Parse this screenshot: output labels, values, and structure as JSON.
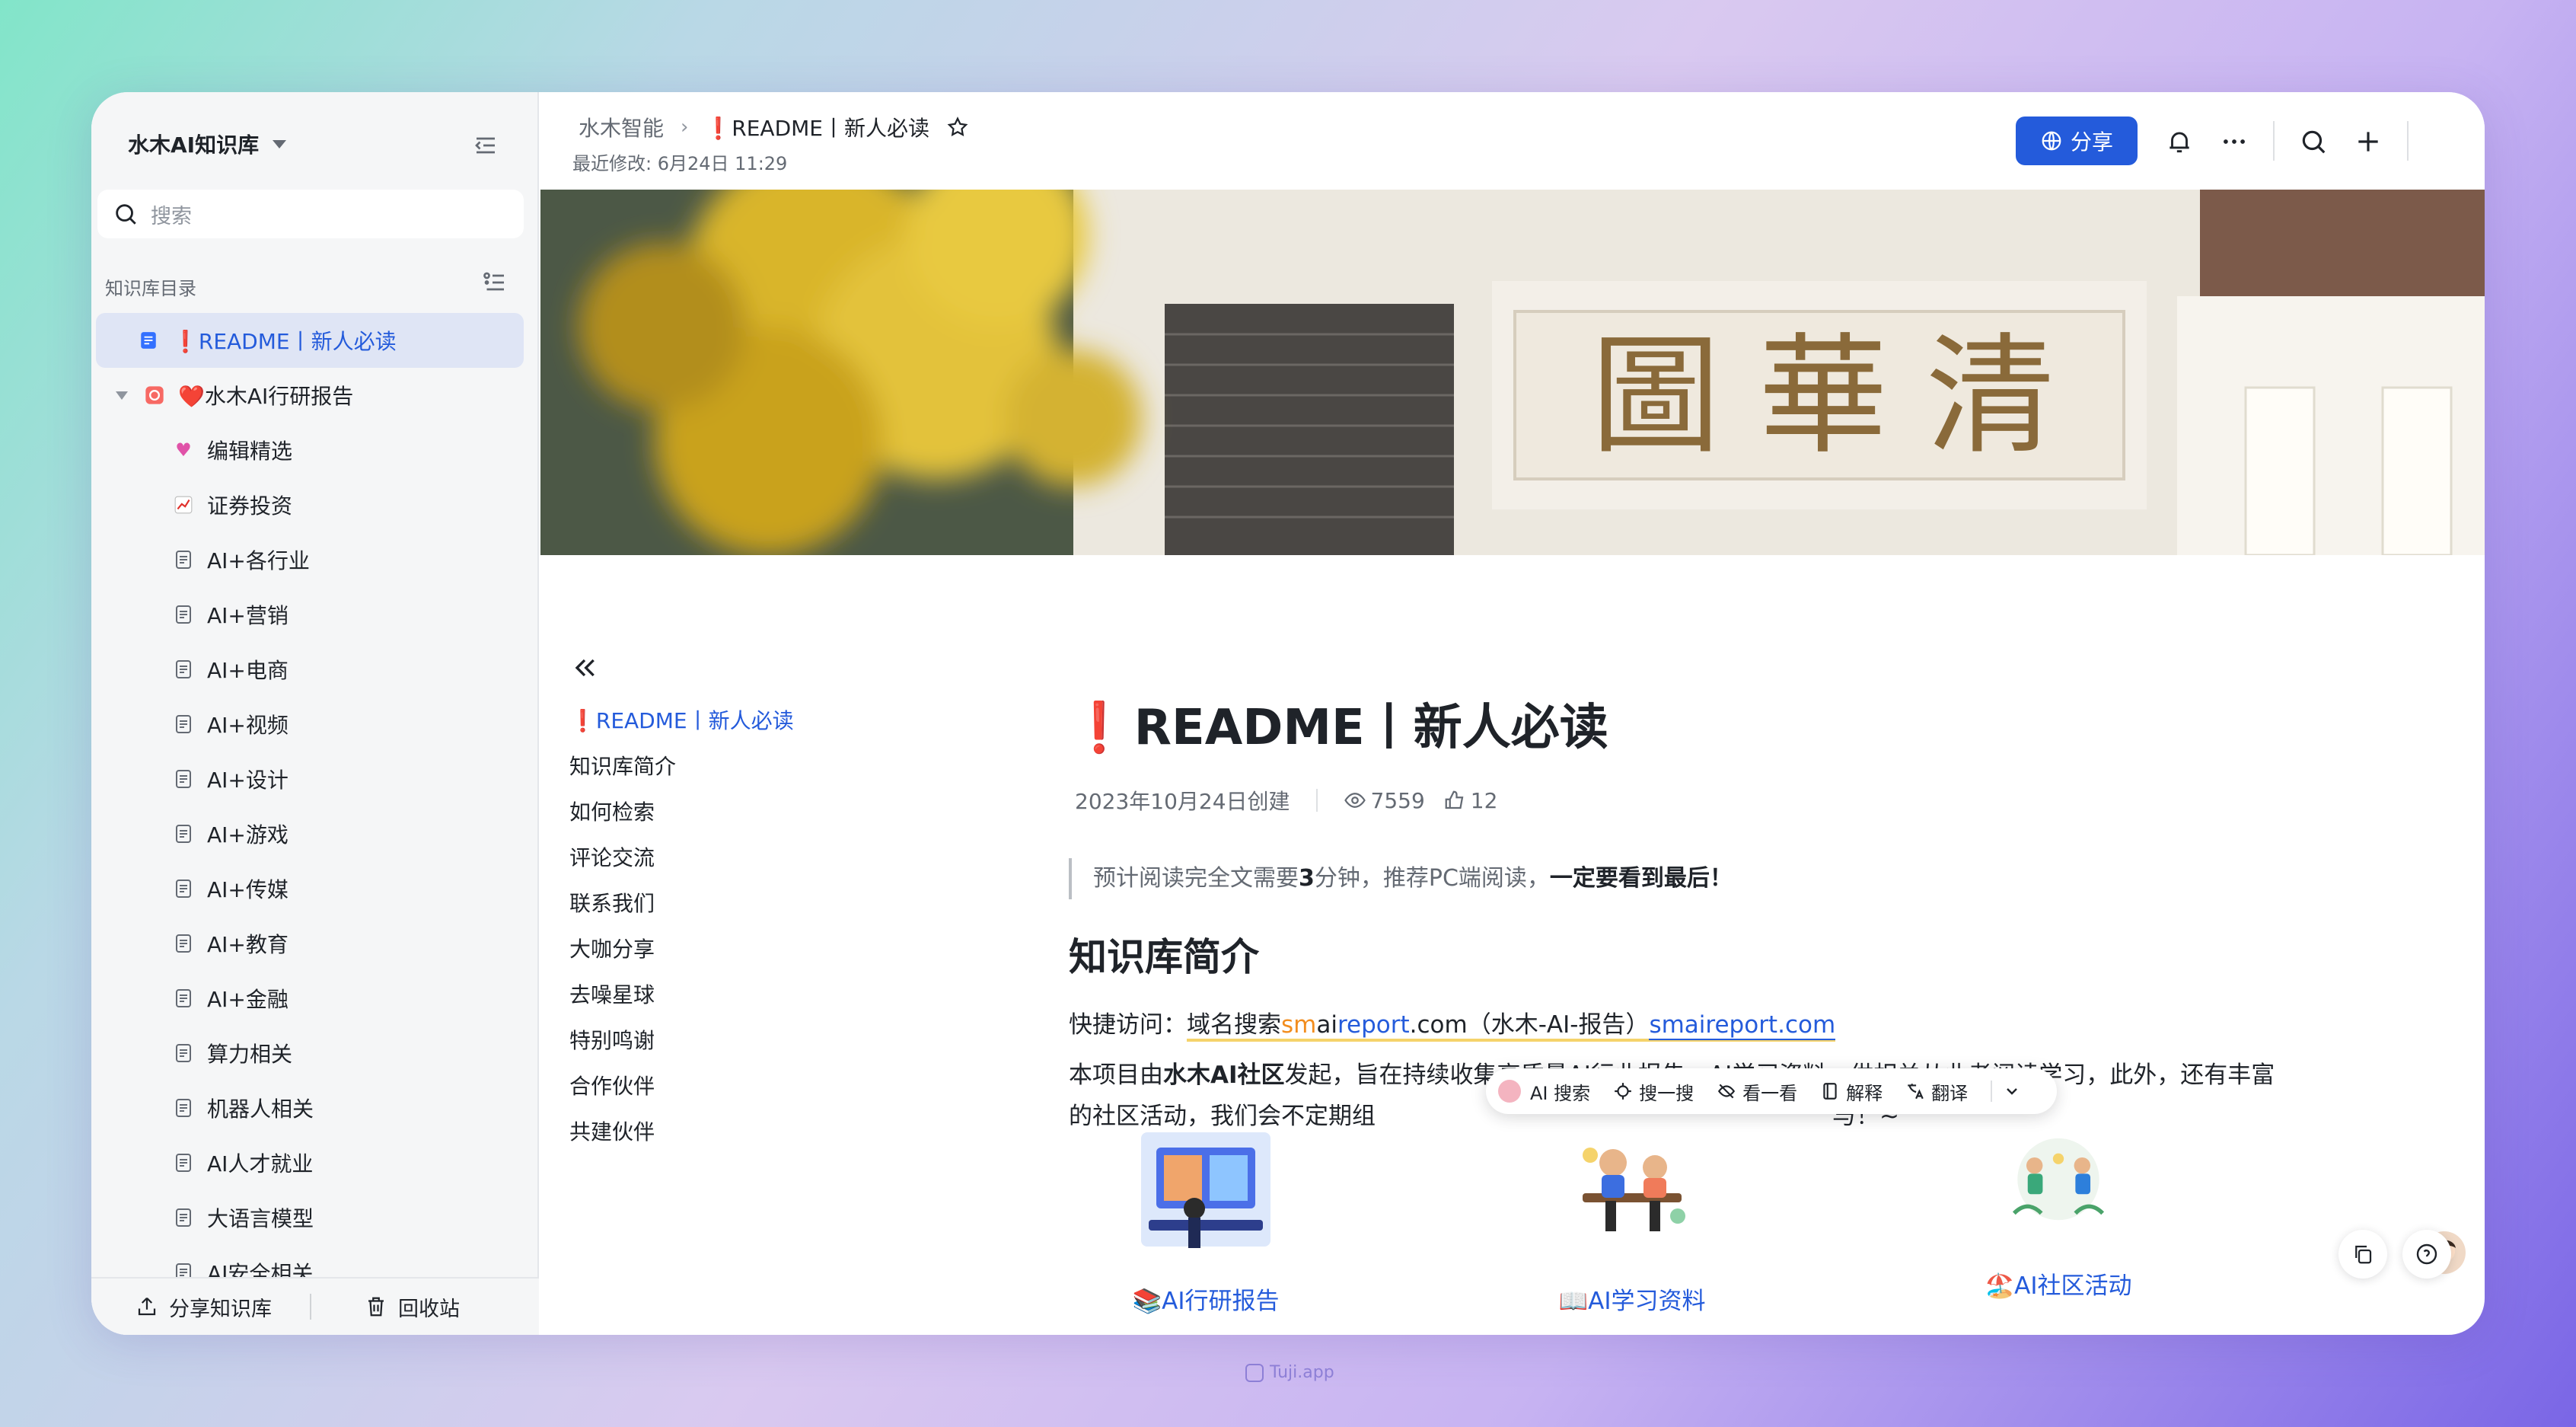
{
  "sidebar": {
    "title": "水木AI知识库",
    "search_placeholder": "搜索",
    "toc_label": "知识库目录",
    "items": [
      {
        "label": "❗README丨新人必读",
        "icon": "doc-icon",
        "active": true
      },
      {
        "label": "❤️水木AI行研报告",
        "icon": "folder-icon"
      },
      {
        "label": "编辑精选",
        "icon": "pink-heart-emoji"
      },
      {
        "label": "证券投资",
        "icon": "chart-emoji"
      },
      {
        "label": "AI+各行业",
        "icon": "doc-icon"
      },
      {
        "label": "AI+营销",
        "icon": "doc-icon"
      },
      {
        "label": "AI+电商",
        "icon": "doc-icon"
      },
      {
        "label": "AI+视频",
        "icon": "doc-icon"
      },
      {
        "label": "AI+设计",
        "icon": "doc-icon"
      },
      {
        "label": "AI+游戏",
        "icon": "doc-icon"
      },
      {
        "label": "AI+传媒",
        "icon": "doc-icon"
      },
      {
        "label": "AI+教育",
        "icon": "doc-icon"
      },
      {
        "label": "AI+金融",
        "icon": "doc-icon"
      },
      {
        "label": "算力相关",
        "icon": "doc-icon"
      },
      {
        "label": "机器人相关",
        "icon": "doc-icon"
      },
      {
        "label": "AI人才就业",
        "icon": "doc-icon"
      },
      {
        "label": "大语言模型",
        "icon": "doc-icon"
      },
      {
        "label": "AI安全相关",
        "icon": "doc-icon"
      }
    ],
    "footer": {
      "share": "分享知识库",
      "trash": "回收站"
    }
  },
  "header": {
    "breadcrumb_root": "水木智能",
    "breadcrumb_current": "❗README丨新人必读",
    "modified": "最近修改: 6月24日 11:29",
    "share_label": "分享"
  },
  "outline": {
    "items": [
      "❗README丨新人必读",
      "知识库简介",
      "如何检索",
      "评论交流",
      "联系我们",
      "大咖分享",
      "去噪星球",
      "特别鸣谢",
      "合作伙伴",
      "共建伙伴"
    ]
  },
  "doc": {
    "title": "README丨新人必读",
    "title_mark": "❗",
    "created": "2023年10月24日创建",
    "views": "7559",
    "likes": "12",
    "quote_a": "预计阅读完全文需要",
    "quote_b": "3",
    "quote_c": "分钟，推荐PC端阅读，",
    "quote_d": "一定要看到最后！",
    "h2": "知识库简介",
    "quick_prefix": "快捷访问：",
    "quick_search": "域名搜索",
    "quick_sm": "sm",
    "quick_ai": "ai",
    "quick_report": "report",
    "quick_com": ".com（水木-AI-报告）",
    "quick_link": "smaireport.com",
    "intro_a": "本项目由",
    "intro_b": "水木AI社区",
    "intro_c": "发起，旨在持续收集高质量AI行业报告，AI学习资料，供相关从业者阅读学习，此外，还有丰富",
    "intro_d": "的社区活动，我们会不定期组",
    "intro_e": "与！~"
  },
  "ai_toolbar": {
    "ai_search": "AI 搜索",
    "search": "搜一搜",
    "look": "看一看",
    "explain": "解释",
    "translate": "翻译"
  },
  "cards": [
    {
      "label": "📚AI行研报告"
    },
    {
      "label": "📖AI学习资料"
    },
    {
      "label": "🏖️AI社区活动"
    }
  ],
  "watermark": "Tuji.app",
  "colors": {
    "accent": "#245bdb",
    "sidebar_bg": "#f5f6f7",
    "active_bg": "#dfe5f5"
  }
}
